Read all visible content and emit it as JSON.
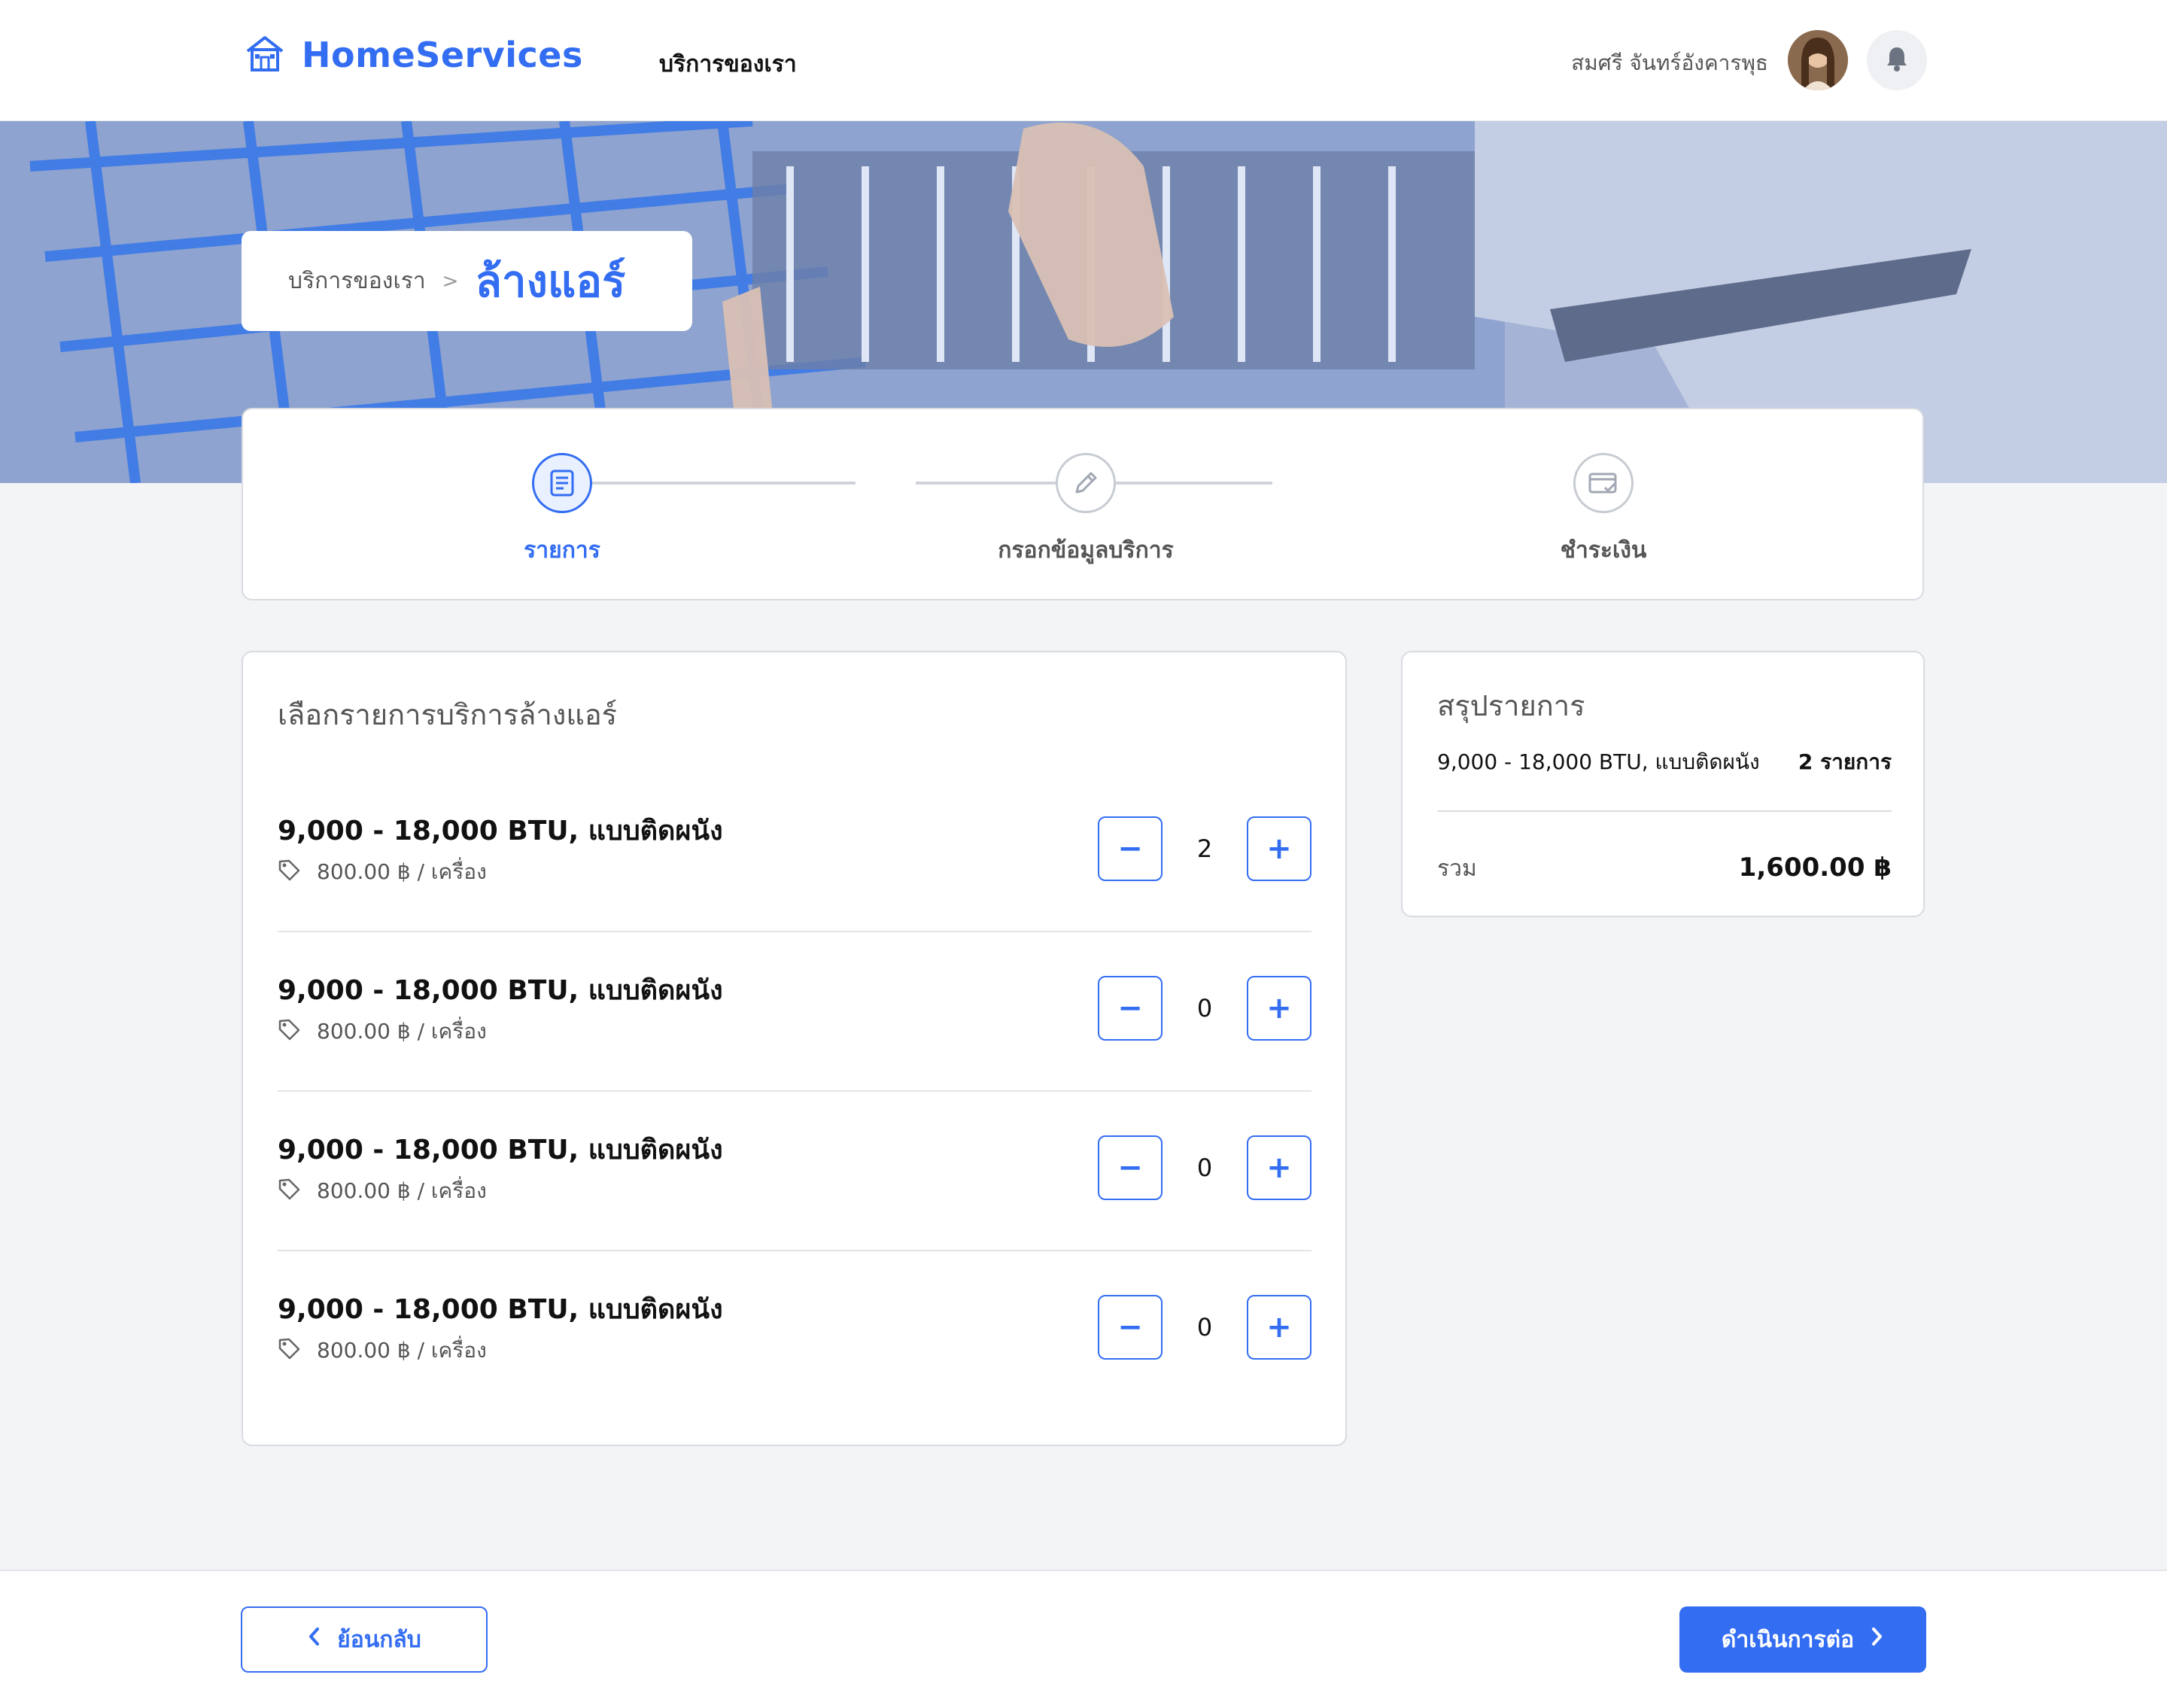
{
  "colors": {
    "accent": "#336DF2",
    "background": "#F3F4F6"
  },
  "nav": {
    "brand": "HomeServices",
    "brand_icon": "house-icon",
    "link": "บริการของเรา",
    "user_name": "สมศรี จันทร์อังคารพุธ",
    "notification_icon": "bell-icon"
  },
  "breadcrumb": {
    "parent": "บริการของเรา",
    "separator": ">",
    "current": "ล้างแอร์"
  },
  "steps": [
    {
      "label": "รายการ",
      "icon": "list-icon",
      "active": true
    },
    {
      "label": "กรอกข้อมูลบริการ",
      "icon": "pencil-icon",
      "active": false
    },
    {
      "label": "ชำระเงิน",
      "icon": "card-check-icon",
      "active": false
    }
  ],
  "service_list": {
    "title": "เลือกรายการบริการล้างแอร์",
    "items": [
      {
        "name": "9,000 - 18,000 BTU, แบบติดผนัง",
        "price": "800.00 ฿ / เครื่อง",
        "qty": "2"
      },
      {
        "name": "9,000 - 18,000 BTU, แบบติดผนัง",
        "price": "800.00 ฿ / เครื่อง",
        "qty": "0"
      },
      {
        "name": "9,000 - 18,000 BTU, แบบติดผนัง",
        "price": "800.00 ฿ / เครื่อง",
        "qty": "0"
      },
      {
        "name": "9,000 - 18,000 BTU, แบบติดผนัง",
        "price": "800.00 ฿ / เครื่อง",
        "qty": "0"
      }
    ],
    "minus_label": "−",
    "plus_label": "+"
  },
  "summary": {
    "title": "สรุปรายการ",
    "row_name": "9,000 - 18,000 BTU, แบบติดผนัง",
    "row_count": "2 รายการ",
    "total_label": "รวม",
    "total_value": "1,600.00 ฿"
  },
  "footer": {
    "back_label": "ย้อนกลับ",
    "next_label": "ดำเนินการต่อ"
  }
}
